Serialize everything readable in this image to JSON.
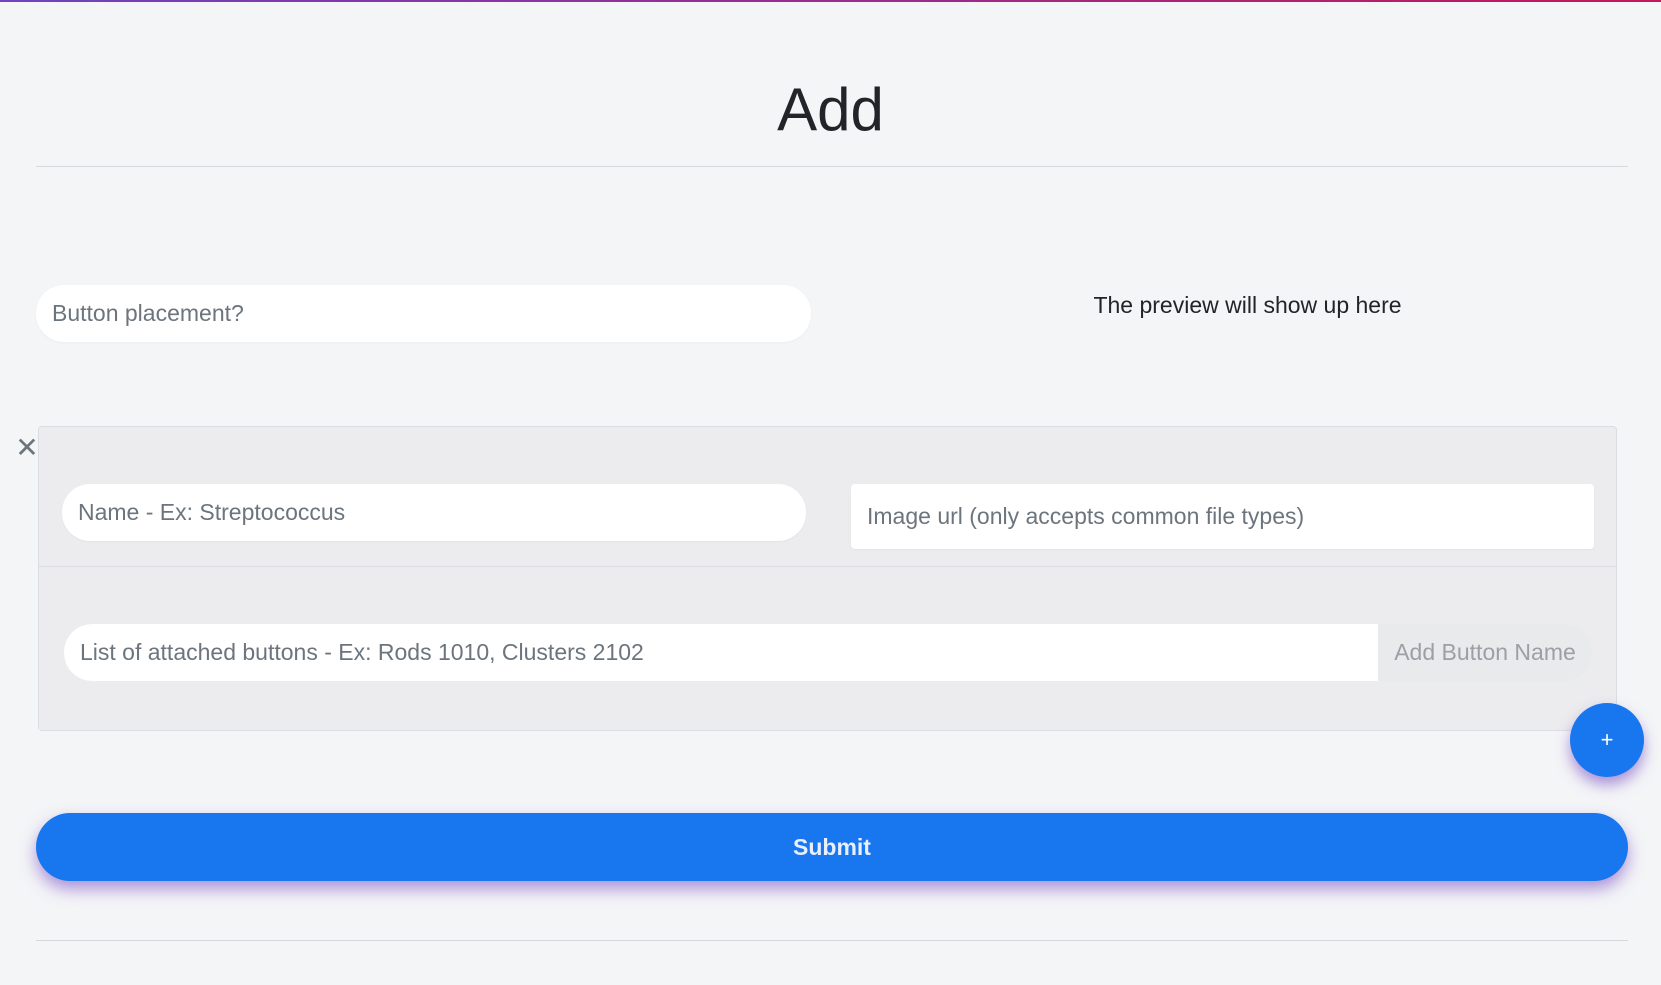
{
  "page": {
    "title": "Add"
  },
  "form": {
    "placement_placeholder": "Button placement?",
    "preview_text": "The preview will show up here",
    "entry": {
      "close_symbol": "✕",
      "name_placeholder": "Name - Ex: Streptococcus",
      "image_url_placeholder": "Image url (only accepts common file types)",
      "buttons_list_placeholder": "List of attached buttons - Ex: Rods 1010, Clusters 2102",
      "add_button_name_label": "Add Button Name"
    },
    "add_entry_label": "+",
    "submit_label": "Submit"
  },
  "colors": {
    "primary": "#1877ee",
    "background": "#f4f5f7",
    "card": "#ececee",
    "shadow": "#6f42c1"
  }
}
